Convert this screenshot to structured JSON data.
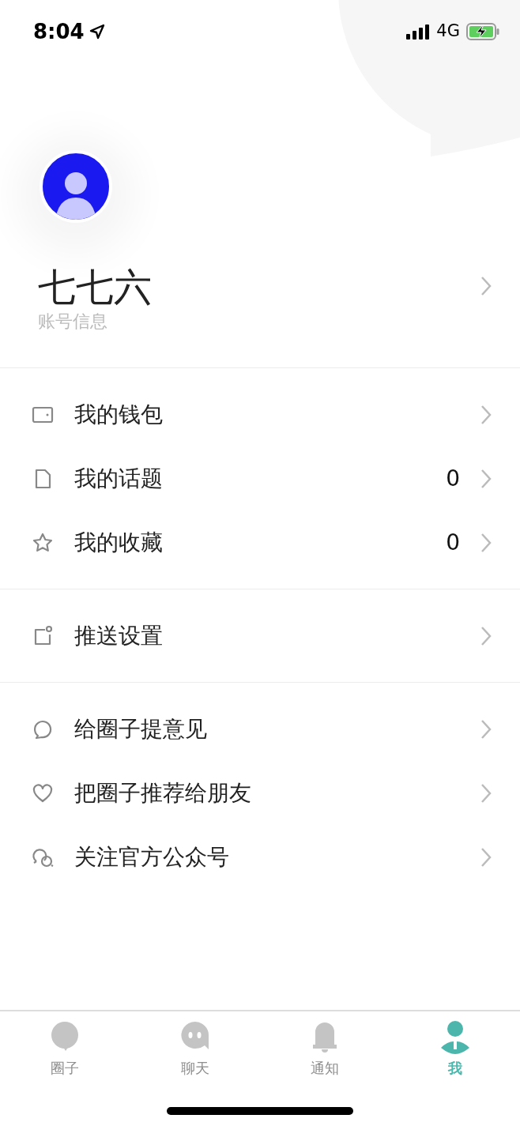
{
  "status_bar": {
    "time": "8:04",
    "network": "4G"
  },
  "profile": {
    "name": "七七六",
    "subtitle": "账号信息"
  },
  "menu_sections": [
    [
      {
        "label": "我的钱包"
      },
      {
        "label": "我的话题",
        "count": "0"
      },
      {
        "label": "我的收藏",
        "count": "0"
      }
    ],
    [
      {
        "label": "推送设置"
      }
    ],
    [
      {
        "label": "给圈子提意见"
      },
      {
        "label": "把圈子推荐给朋友"
      },
      {
        "label": "关注官方公众号"
      }
    ]
  ],
  "tab_bar": [
    {
      "label": "圈子",
      "selected": false
    },
    {
      "label": "聊天",
      "selected": false
    },
    {
      "label": "通知",
      "selected": false
    },
    {
      "label": "我",
      "selected": true
    }
  ]
}
